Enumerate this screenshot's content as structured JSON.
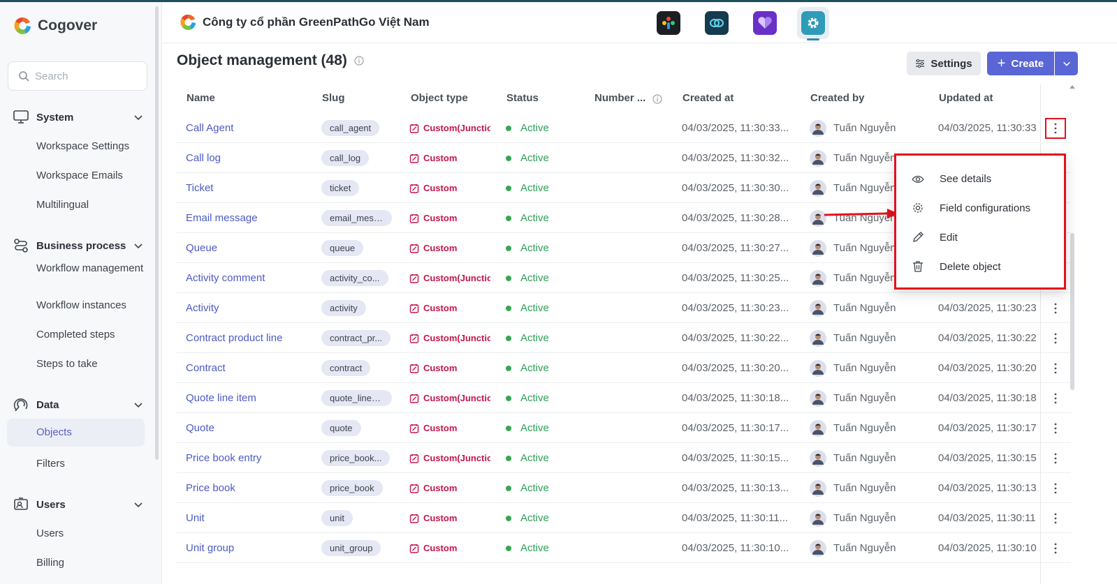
{
  "brand": {
    "name": "Cogover",
    "logo_icon": "cogover-logo"
  },
  "search": {
    "placeholder": "Search"
  },
  "sidebar": {
    "sections": [
      {
        "title": "System",
        "icon": "monitor-icon",
        "items": [
          "Workspace Settings",
          "Workspace Emails",
          "Multilingual"
        ]
      },
      {
        "title": "Business process",
        "icon": "process-icon",
        "items": [
          "Workflow management",
          "Workflow instances",
          "Completed steps",
          "Steps to take"
        ]
      },
      {
        "title": "Data",
        "icon": "data-icon",
        "items": [
          "Objects",
          "Filters"
        ]
      },
      {
        "title": "Users",
        "icon": "users-icon",
        "items": [
          "Users",
          "Billing"
        ]
      }
    ],
    "active_item": "Objects"
  },
  "header": {
    "company": "Công ty cổ phần GreenPathGo Việt Nam",
    "apps": [
      {
        "name": "people-app-icon",
        "color": "#1b1f23"
      },
      {
        "name": "link-app-icon",
        "color": "#163a4e"
      },
      {
        "name": "heart-app-icon",
        "color": "#6a2fc7"
      },
      {
        "name": "gear-app-icon",
        "color": "#2f9bb8",
        "selected": true
      }
    ]
  },
  "page": {
    "title": "Object management (48)",
    "settings_label": "Settings",
    "create_label": "Create"
  },
  "table": {
    "columns": [
      "Name",
      "Slug",
      "Object type",
      "Status",
      "Number ...",
      "Created at",
      "Created by",
      "Updated at"
    ],
    "rows": [
      {
        "name": "Call Agent",
        "slug": "call_agent",
        "type": "Custom(Junction",
        "status": "Active",
        "created": "04/03/2025, 11:30:33...",
        "by": "Tuấn Nguyễn",
        "updated": "04/03/2025, 11:30:33"
      },
      {
        "name": "Call log",
        "slug": "call_log",
        "type": "Custom",
        "status": "Active",
        "created": "04/03/2025, 11:30:32...",
        "by": "Tuấn Nguyễn",
        "updated": ""
      },
      {
        "name": "Ticket",
        "slug": "ticket",
        "type": "Custom",
        "status": "Active",
        "created": "04/03/2025, 11:30:30...",
        "by": "Tuấn Nguyễn",
        "updated": ""
      },
      {
        "name": "Email message",
        "slug": "email_mess...",
        "type": "Custom",
        "status": "Active",
        "created": "04/03/2025, 11:30:28...",
        "by": "Tuấn Nguyễn",
        "updated": ""
      },
      {
        "name": "Queue",
        "slug": "queue",
        "type": "Custom",
        "status": "Active",
        "created": "04/03/2025, 11:30:27...",
        "by": "Tuấn Nguyễn",
        "updated": ""
      },
      {
        "name": "Activity comment",
        "slug": "activity_co...",
        "type": "Custom(Junction",
        "status": "Active",
        "created": "04/03/2025, 11:30:25...",
        "by": "Tuấn Nguyễn",
        "updated": ""
      },
      {
        "name": "Activity",
        "slug": "activity",
        "type": "Custom",
        "status": "Active",
        "created": "04/03/2025, 11:30:23...",
        "by": "Tuấn Nguyễn",
        "updated": "04/03/2025, 11:30:23"
      },
      {
        "name": "Contract product line",
        "slug": "contract_pr...",
        "type": "Custom(Junction",
        "status": "Active",
        "created": "04/03/2025, 11:30:22...",
        "by": "Tuấn Nguyễn",
        "updated": "04/03/2025, 11:30:22"
      },
      {
        "name": "Contract",
        "slug": "contract",
        "type": "Custom",
        "status": "Active",
        "created": "04/03/2025, 11:30:20...",
        "by": "Tuấn Nguyễn",
        "updated": "04/03/2025, 11:30:20"
      },
      {
        "name": "Quote line item",
        "slug": "quote_line_...",
        "type": "Custom(Junction",
        "status": "Active",
        "created": "04/03/2025, 11:30:18...",
        "by": "Tuấn Nguyễn",
        "updated": "04/03/2025, 11:30:18"
      },
      {
        "name": "Quote",
        "slug": "quote",
        "type": "Custom",
        "status": "Active",
        "created": "04/03/2025, 11:30:17...",
        "by": "Tuấn Nguyễn",
        "updated": "04/03/2025, 11:30:17"
      },
      {
        "name": "Price book entry",
        "slug": "price_book...",
        "type": "Custom(Junction",
        "status": "Active",
        "created": "04/03/2025, 11:30:15...",
        "by": "Tuấn Nguyễn",
        "updated": "04/03/2025, 11:30:15"
      },
      {
        "name": "Price book",
        "slug": "price_book",
        "type": "Custom",
        "status": "Active",
        "created": "04/03/2025, 11:30:13...",
        "by": "Tuấn Nguyễn",
        "updated": "04/03/2025, 11:30:13"
      },
      {
        "name": "Unit",
        "slug": "unit",
        "type": "Custom",
        "status": "Active",
        "created": "04/03/2025, 11:30:11...",
        "by": "Tuấn Nguyễn",
        "updated": "04/03/2025, 11:30:11"
      },
      {
        "name": "Unit group",
        "slug": "unit_group",
        "type": "Custom",
        "status": "Active",
        "created": "04/03/2025, 11:30:10...",
        "by": "Tuấn Nguyễn",
        "updated": "04/03/2025, 11:30:10"
      }
    ]
  },
  "context_menu": {
    "items": [
      {
        "label": "See details",
        "icon": "eye-icon"
      },
      {
        "label": "Field configurations",
        "icon": "gear-icon"
      },
      {
        "label": "Edit",
        "icon": "pencil-icon"
      },
      {
        "label": "Delete object",
        "icon": "trash-icon"
      }
    ]
  },
  "colors": {
    "accent": "#5a66d6",
    "custom_type": "#c4154a",
    "active": "#2e9e58",
    "highlight": "#e3101c"
  }
}
